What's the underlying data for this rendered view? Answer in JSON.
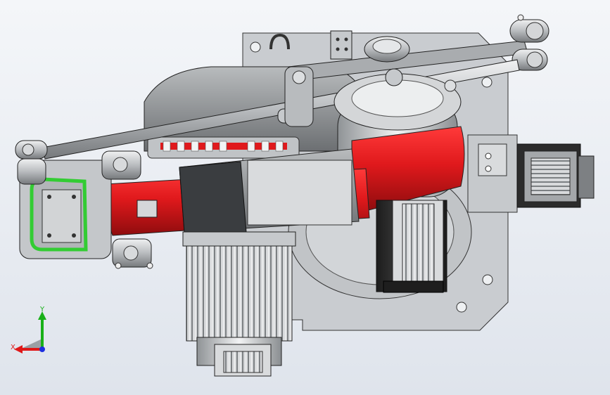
{
  "scene": {
    "background_top": "#f4f6f9",
    "background_bottom": "#dfe4ec",
    "colors": {
      "plate": "#c9ccd0",
      "housing": "#9da0a3",
      "dark_housing": "#6f7275",
      "red_part": "#e0191c",
      "green_selection": "#33cc33",
      "steel": "#b4b8bc",
      "motor_dark": "#2c2c2c"
    }
  },
  "triad": {
    "x_label": "X",
    "y_label": "Y",
    "x_color": "#e01818",
    "y_color": "#18b018",
    "z_color": "#1c2ee0"
  }
}
